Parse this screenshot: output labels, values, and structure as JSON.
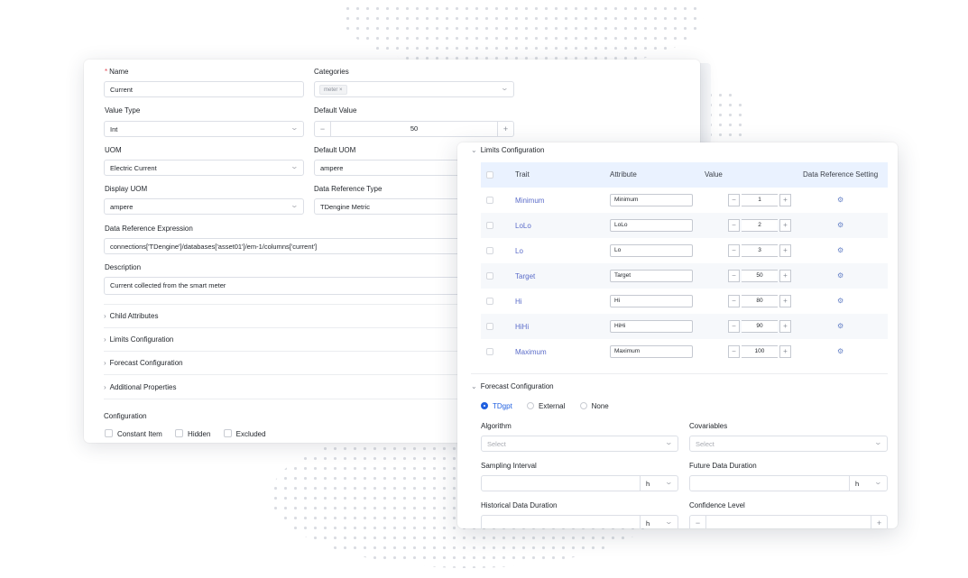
{
  "attribute_form": {
    "name": {
      "label": "Name",
      "value": "Current"
    },
    "categories": {
      "label": "Categories",
      "tag": "meter",
      "tag_remove": "×"
    },
    "value_type": {
      "label": "Value Type",
      "value": "Int"
    },
    "default_value": {
      "label": "Default Value",
      "value": "50",
      "minus": "−",
      "plus": "+"
    },
    "uom": {
      "label": "UOM",
      "value": "Electric Current"
    },
    "default_uom": {
      "label": "Default UOM",
      "value": "ampere"
    },
    "display_uom": {
      "label": "Display UOM",
      "value": "ampere"
    },
    "data_reference_type": {
      "label": "Data Reference Type",
      "value": "TDengine Metric"
    },
    "data_reference_expression": {
      "label": "Data Reference Expression",
      "value": "connections['TDengine']/databases['asset01']/em-1/columns['current']"
    },
    "description": {
      "label": "Description",
      "value": "Current collected from the smart meter"
    },
    "sections": [
      "Child Attributes",
      "Limits Configuration",
      "Forecast Configuration",
      "Additional Properties"
    ],
    "configuration": {
      "label": "Configuration",
      "options": [
        "Constant Item",
        "Hidden",
        "Excluded"
      ]
    }
  },
  "limits": {
    "title": "Limits Configuration",
    "columns": [
      "Trait",
      "Attribute",
      "Value",
      "Data Reference Setting"
    ],
    "rows": [
      {
        "trait": "Minimum",
        "attribute": "Minimum",
        "value": "1"
      },
      {
        "trait": "LoLo",
        "attribute": "LoLo",
        "value": "2"
      },
      {
        "trait": "Lo",
        "attribute": "Lo",
        "value": "3"
      },
      {
        "trait": "Target",
        "attribute": "Target",
        "value": "50"
      },
      {
        "trait": "Hi",
        "attribute": "Hi",
        "value": "80"
      },
      {
        "trait": "HiHi",
        "attribute": "HiHi",
        "value": "90"
      },
      {
        "trait": "Maximum",
        "attribute": "Maximum",
        "value": "100"
      }
    ],
    "minus": "−",
    "plus": "+",
    "gear": "⚙"
  },
  "forecast": {
    "title": "Forecast Configuration",
    "methods": [
      "TDgpt",
      "External",
      "None"
    ],
    "selected_method": "TDgpt",
    "algorithm": {
      "label": "Algorithm",
      "placeholder": "Select"
    },
    "covariables": {
      "label": "Covariables",
      "placeholder": "Select"
    },
    "sampling_interval": {
      "label": "Sampling Interval",
      "unit": "h"
    },
    "future_data_duration": {
      "label": "Future Data Duration",
      "unit": "h"
    },
    "historical_data_duration": {
      "label": "Historical Data Duration",
      "unit": "h"
    },
    "confidence_level": {
      "label": "Confidence Level",
      "minus": "−",
      "plus": "+"
    }
  },
  "icons": {
    "chevron_down": "⌄",
    "chevron_right": "›",
    "required_mark": "*"
  },
  "colors": {
    "accent": "#1f5fe0",
    "table_header": "#eaf2ff",
    "trait_text": "#5b6cc9"
  }
}
